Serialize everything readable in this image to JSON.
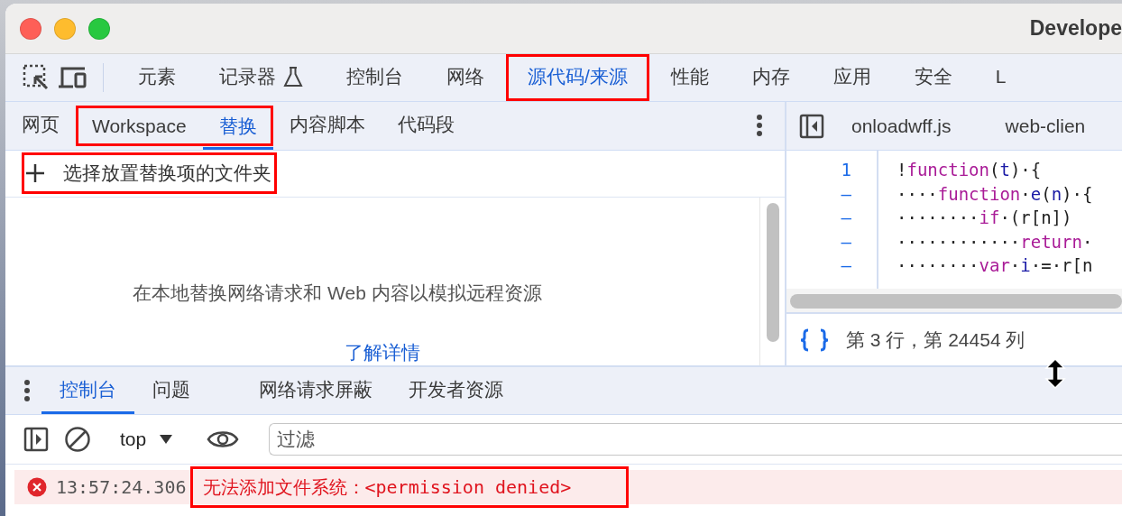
{
  "window": {
    "title": "Develope"
  },
  "main_tabs": [
    {
      "label": "元素",
      "selected": false,
      "highlighted": false
    },
    {
      "label": "记录器",
      "selected": false,
      "highlighted": false,
      "kind": "experiment"
    },
    {
      "label": "控制台",
      "selected": false,
      "highlighted": false
    },
    {
      "label": "网络",
      "selected": false,
      "highlighted": false
    },
    {
      "label": "源代码/来源",
      "selected": true,
      "highlighted": true
    },
    {
      "label": "性能",
      "selected": false,
      "highlighted": false
    },
    {
      "label": "内存",
      "selected": false,
      "highlighted": false
    },
    {
      "label": "应用",
      "selected": false,
      "highlighted": false
    },
    {
      "label": "安全",
      "selected": false,
      "highlighted": false
    },
    {
      "label": "L",
      "selected": false,
      "highlighted": false
    }
  ],
  "navigator": {
    "tabs": [
      {
        "label": "网页",
        "selected": false,
        "highlighted": false
      },
      {
        "label": "Workspace",
        "selected": false,
        "highlighted": true
      },
      {
        "label": "替换",
        "selected": true,
        "highlighted": true
      },
      {
        "label": "内容脚本",
        "selected": false,
        "highlighted": false
      },
      {
        "label": "代码段",
        "selected": false,
        "highlighted": false
      }
    ],
    "add_folder": {
      "label": "选择放置替换项的文件夹",
      "highlighted": true
    },
    "empty_message": "在本地替换网络请求和 Web 内容以模拟远程资源",
    "learn_more_link": "了解详情"
  },
  "editor": {
    "files": [
      {
        "label": "onloadwff.js",
        "selected": false
      },
      {
        "label": "web-clien",
        "selected": false
      }
    ],
    "gutter": [
      "1",
      "–",
      "–",
      "–",
      "–"
    ],
    "lines": [
      [
        {
          "kind": "plain",
          "text": "!"
        },
        {
          "kind": "keyword",
          "text": "function"
        },
        {
          "kind": "plain",
          "text": "("
        },
        {
          "kind": "variable",
          "text": "t"
        },
        {
          "kind": "plain",
          "text": ")·{"
        }
      ],
      [
        {
          "kind": "plain",
          "text": "····"
        },
        {
          "kind": "keyword",
          "text": "function"
        },
        {
          "kind": "plain",
          "text": "·"
        },
        {
          "kind": "variable",
          "text": "e"
        },
        {
          "kind": "plain",
          "text": "("
        },
        {
          "kind": "variable",
          "text": "n"
        },
        {
          "kind": "plain",
          "text": ")·{"
        }
      ],
      [
        {
          "kind": "plain",
          "text": "········"
        },
        {
          "kind": "keyword",
          "text": "if"
        },
        {
          "kind": "plain",
          "text": "·(r[n])"
        }
      ],
      [
        {
          "kind": "plain",
          "text": "············"
        },
        {
          "kind": "keyword",
          "text": "return"
        },
        {
          "kind": "plain",
          "text": "·"
        }
      ],
      [
        {
          "kind": "plain",
          "text": "········"
        },
        {
          "kind": "keyword",
          "text": "var"
        },
        {
          "kind": "plain",
          "text": "·"
        },
        {
          "kind": "variable",
          "text": "i"
        },
        {
          "kind": "plain",
          "text": "·=·r[n"
        }
      ]
    ],
    "status": "第 3 行，第 24454 列"
  },
  "drawer": {
    "tabs": [
      {
        "label": "控制台",
        "selected": true
      },
      {
        "label": "问题",
        "selected": false
      },
      {
        "label": "网络请求屏蔽",
        "selected": false
      },
      {
        "label": "开发者资源",
        "selected": false
      }
    ],
    "context": "top",
    "filter": {
      "placeholder": "过滤"
    },
    "messages": [
      {
        "kind": "error",
        "time": "13:57:24.306",
        "text": "无法添加文件系统：<permission denied>",
        "highlighted": true
      }
    ]
  }
}
